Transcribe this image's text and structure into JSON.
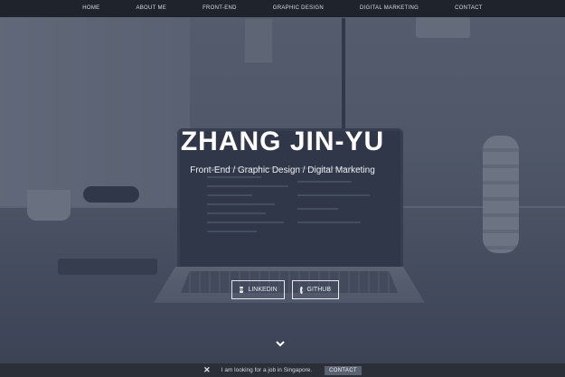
{
  "nav": {
    "items": [
      "HOME",
      "ABOUT ME",
      "FRONT-END",
      "GRAPHIC DESIGN",
      "DIGITAL MARKETING",
      "CONTACT"
    ]
  },
  "hero": {
    "title": "ZHANG JIN-YU",
    "subtitle": "Front-End / Graphic Design / Digital Marketing"
  },
  "social": {
    "linkedin_label": "LINKEDIN",
    "linkedin_icon": "linkedin-icon",
    "github_label": "GITHUB",
    "github_icon": "github-icon"
  },
  "scroll": {
    "icon": "chevron-down-icon"
  },
  "notice": {
    "close_icon": "close-icon",
    "message": "I am looking for a job in Singapore.",
    "button_label": "CONTACT"
  },
  "colors": {
    "nav_bg": "#1f232b",
    "overlay": "#343c50",
    "notice_bg": "#2a2f38",
    "contact_btn": "#5a6170"
  }
}
